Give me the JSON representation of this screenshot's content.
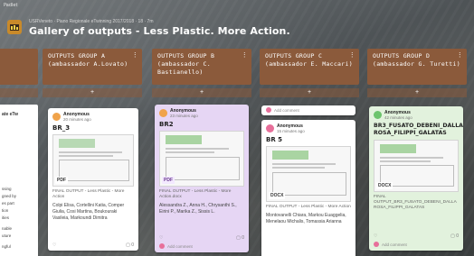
{
  "app": {
    "tag": "Padlet"
  },
  "header": {
    "breadcrumb": "USRVeneto · Piano Regionale eTwinning 2017/2018 · 18 · 7m",
    "title": "Gallery of outputs - Less Plastic. More Action."
  },
  "left_partial": {
    "card_title": "ate eTw",
    "fragments": [
      "ssing",
      "gned by",
      "es part",
      "tion",
      "ities",
      "",
      "nable",
      "uture",
      "",
      "ngful"
    ]
  },
  "columns": [
    {
      "title": "OUTPUTS GROUP A (ambassador A.Lovato)",
      "card": {
        "author": "Anonymous",
        "time": "20 minutes ago",
        "title": "BR_3",
        "file_badge": "PDF",
        "description": "FINAL OUTPUT - Less Plastic - More Action",
        "people": "Colpi Elisa, Cortellini Katia, Comper Giulia, Cosi Martina, Boukouraki Vasileia, Markoundi Dimitra",
        "comments": "0"
      }
    },
    {
      "title": "OUTPUTS GROUP B (ambassador C. Bastianello)",
      "card": {
        "author": "Anonymous",
        "time": "23 minutes ago",
        "title": "BR2",
        "file_badge": "PDF",
        "description": "FINAL OUTPUT - Less Plastic - More Action.docx",
        "people": "Alessandra Z., Anna H., Chrysanthi S., Eirini P., Marika Z., Sissis L.",
        "comments": "0",
        "add_comment": "Add comment"
      }
    },
    {
      "title": "OUTPUTS GROUP C (ambassador E. Maccari)",
      "top_add_comment": "Add comment",
      "card": {
        "author": "Anonymous",
        "time": "15 minutes ago",
        "title": "BR 5",
        "file_badge": "DOCX",
        "description": "FINAL OUTPUT - Less Plastic - More Action",
        "people": "Montovanelli Chiara, Markou Euaggelia, Menelaou Michalis, Tomassia Arianna"
      }
    },
    {
      "title": "OUTPUTS GROUP D (ambassador G. Turetti)",
      "card": {
        "author": "Anonymous",
        "time": "42 minutes ago",
        "title": "BR3_FUSATO_DEBENI_DALLA ROSA_FILIPPI_GALATAS",
        "file_badge": "DOCX",
        "description": "FINAL OUTPUT_BR3_FUSATO_DEBENI_DALLA ROSA_FILIPPI_GALATAS",
        "comments": "0",
        "add_comment": "Add comment"
      }
    }
  ],
  "add_symbol": "+",
  "menu_symbol": "⋮",
  "colors": {
    "column_header": "#8b5a3b",
    "card_default": "#ffffff",
    "card_purple": "#e6d6f4",
    "card_green": "#e2f2dd",
    "avatar_orange": "#f0a34a",
    "avatar_pink": "#e76f9a",
    "avatar_green": "#6cc46d"
  },
  "icons": [
    "padlet-app-icon",
    "menu-dots-icon",
    "add-icon",
    "heart-icon",
    "comment-icon",
    "avatar-icon"
  ]
}
